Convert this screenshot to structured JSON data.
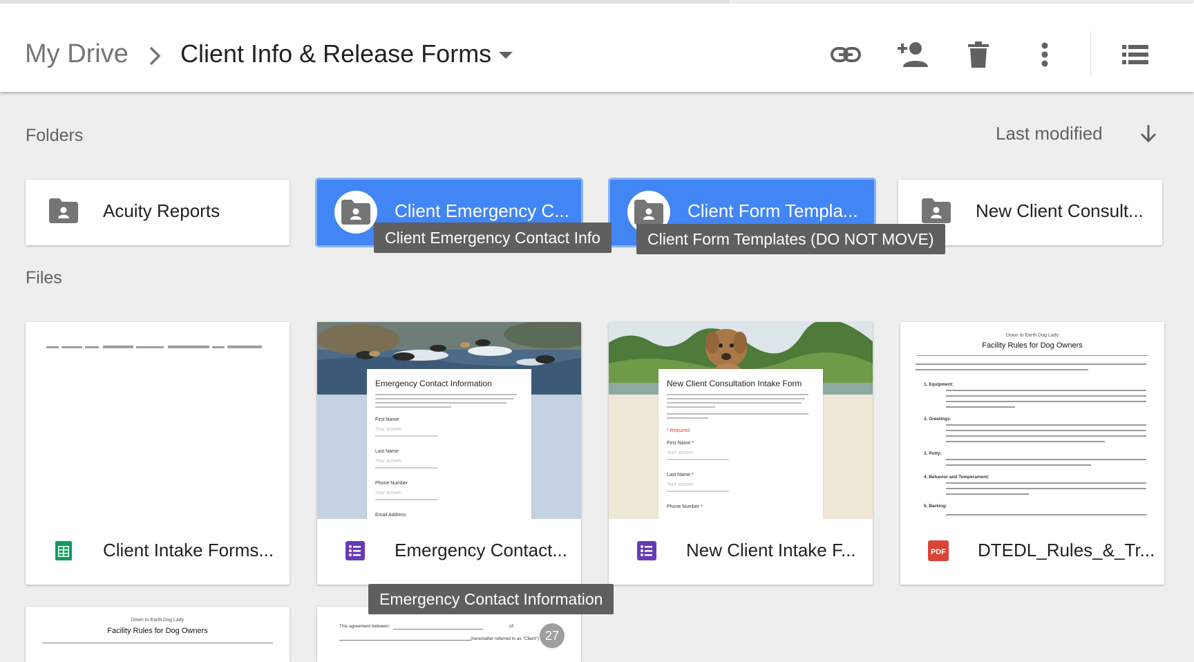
{
  "header": {
    "breadcrumb_root": "My Drive",
    "breadcrumb_current": "Client Info & Release Forms",
    "icons": [
      "link-icon",
      "add-person-icon",
      "trash-icon",
      "more-vert-icon",
      "list-view-icon"
    ]
  },
  "sections": {
    "folders": "Folders",
    "files": "Files"
  },
  "sort": {
    "label": "Last modified",
    "direction": "descending"
  },
  "folders": [
    {
      "label": "Acuity Reports",
      "selected": false
    },
    {
      "label": "Client Emergency C...",
      "selected": true
    },
    {
      "label": "Client Form Templa...",
      "selected": true
    },
    {
      "label": "New Client Consult...",
      "selected": false
    }
  ],
  "tooltips": {
    "folder1": "Client Emergency Contact Info",
    "folder2": "Client Form Templates (DO NOT MOVE)",
    "file1": "Emergency Contact Information"
  },
  "files": [
    {
      "name": "Client Intake Forms...",
      "type": "sheets"
    },
    {
      "name": "Emergency Contact...",
      "type": "forms"
    },
    {
      "name": "New Client Intake F...",
      "type": "forms"
    },
    {
      "name": "DTEDL_Rules_&_Tr...",
      "type": "pdf"
    }
  ],
  "thumbs": {
    "emergency": {
      "title": "Emergency Contact Information",
      "fields": [
        "First Name",
        "Last Name",
        "Phone Number",
        "Email Address"
      ],
      "answer": "Your answer"
    },
    "intake": {
      "title": "New Client Consultation Intake Form",
      "required": "* Required",
      "fields": [
        "First Name *",
        "Last Name *",
        "Phone Number *"
      ],
      "answer": "Your answer"
    },
    "rules": {
      "org": "Down to Earth Dog Lady",
      "title": "Facility Rules for Dog Owners",
      "sections": [
        "1. Equipment:",
        "2. Greetings:",
        "3. Potty:",
        "4. Behavior and Temperament:",
        "5. Barking:"
      ]
    },
    "agreement": {
      "text1": "This agreement between:",
      "text2": "of:",
      "text3": "(hereinafter referred to as \"Client\")"
    }
  },
  "badge": "27",
  "colors": {
    "accent": "#4285f4",
    "sheets": "#0f9d58",
    "forms": "#673ab7",
    "pdf": "#db4437"
  }
}
